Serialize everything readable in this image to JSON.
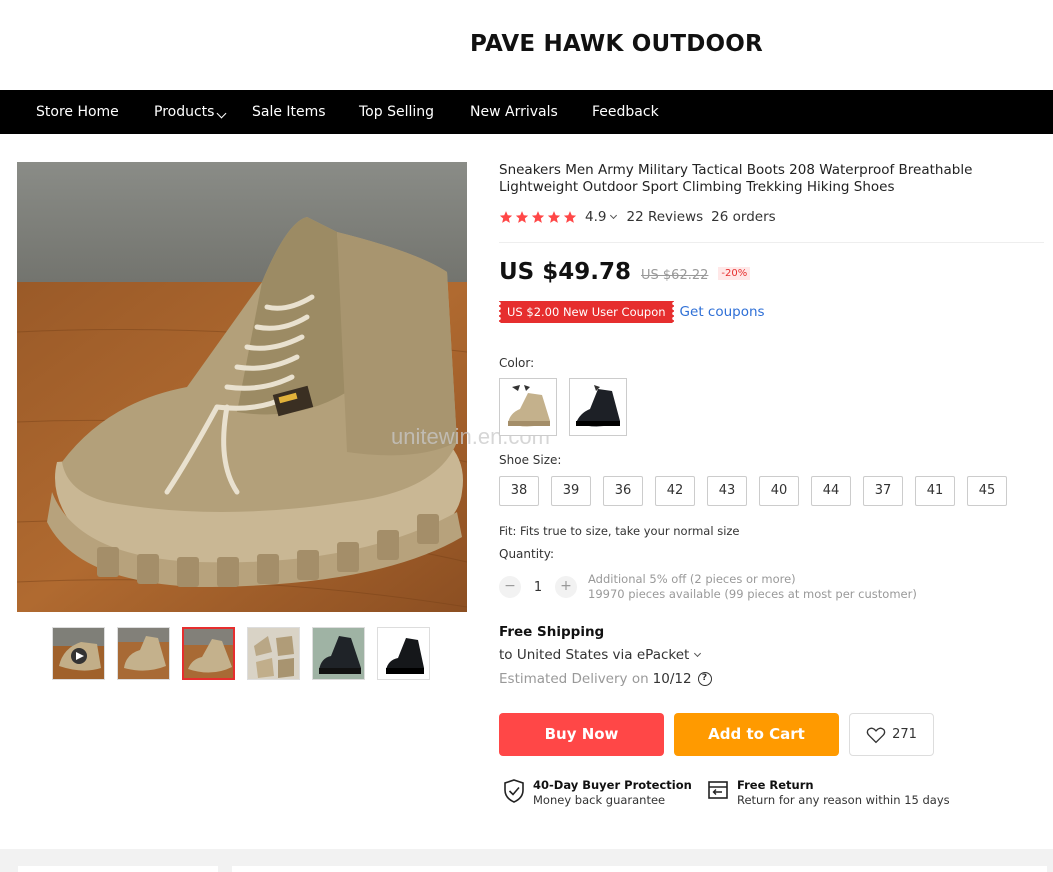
{
  "store": {
    "name": "PAVE HAWK OUTDOOR"
  },
  "nav": {
    "items": [
      "Store Home",
      "Products",
      "Sale Items",
      "Top Selling",
      "New Arrivals",
      "Feedback"
    ]
  },
  "watermark": "unitewin.en.com",
  "product": {
    "title": "Sneakers Men Army Military Tactical Boots 208 Waterproof Breathable Lightweight Outdoor Sport Climbing Trekking Hiking Shoes",
    "rating": "4.9",
    "reviews": "22 Reviews",
    "orders": "26 orders",
    "price": "US $49.78",
    "old_price": "US $62.22",
    "discount": "-20%",
    "coupon": "US $2.00 New User Coupon",
    "get_coupons": "Get coupons",
    "color_label": "Color:",
    "size_label": "Shoe Size:",
    "sizes": [
      "38",
      "39",
      "36",
      "42",
      "43",
      "40",
      "44",
      "37",
      "41",
      "45"
    ],
    "fit": "Fit: Fits true to size, take your normal size",
    "quantity_label": "Quantity:",
    "quantity": "1",
    "qty_minus": "−",
    "qty_plus": "+",
    "additional": "Additional 5% off (2 pieces or more)",
    "available": "19970 pieces available (99 pieces at most per customer)",
    "shipping_title": "Free Shipping",
    "shipping_to": "to United States via ePacket",
    "delivery_label": "Estimated Delivery on",
    "delivery_date": "10/12",
    "help": "?",
    "buy_now": "Buy Now",
    "add_to_cart": "Add to Cart",
    "wishlist_count": "271",
    "protection_title": "40-Day Buyer Protection",
    "protection_sub": "Money back guarantee",
    "return_title": "Free Return",
    "return_sub": "Return for any reason within 15 days"
  },
  "colors": {
    "accent": "#ff4747",
    "cart": "#ff9a00",
    "link": "#2e6fd6",
    "star": "#ff4747"
  }
}
